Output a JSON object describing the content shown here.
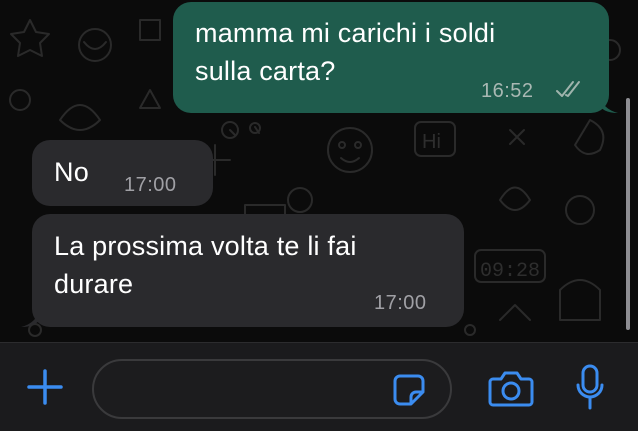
{
  "messages": [
    {
      "direction": "outgoing",
      "text": "mamma mi carichi i soldi\nsulla carta?",
      "time": "16:52",
      "status": "read"
    },
    {
      "direction": "incoming",
      "text": "No",
      "time": "17:00"
    },
    {
      "direction": "incoming",
      "text": "La prossima volta te li fai\ndurare",
      "time": "17:00"
    }
  ],
  "composer": {
    "input_value": "",
    "icons": [
      "plus-icon",
      "sticker-icon",
      "camera-icon",
      "microphone-icon"
    ]
  },
  "colors": {
    "background": "#0b0b0b",
    "outgoing_bubble": "#1f5c4d",
    "incoming_bubble": "#2a2a2d",
    "accent": "#3b8cf0",
    "read_ticks": "#9fb4ad"
  }
}
